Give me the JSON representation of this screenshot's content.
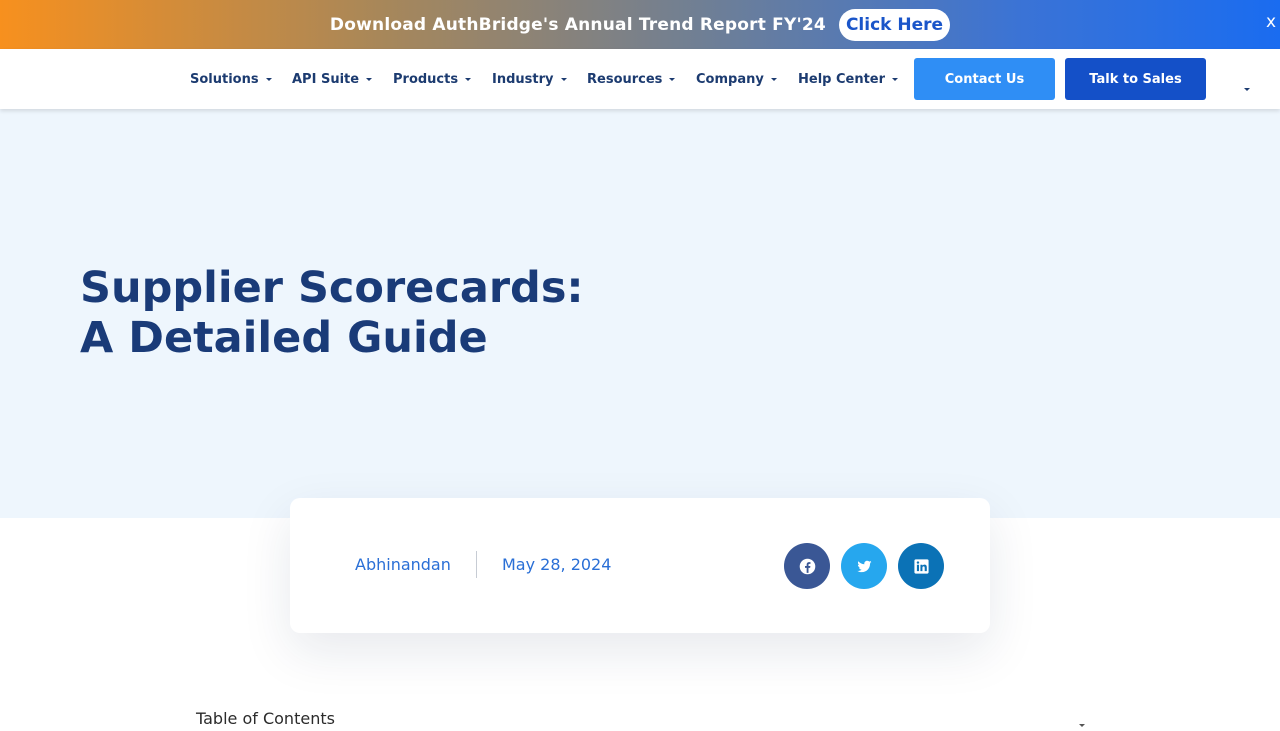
{
  "promo": {
    "text": "Download AuthBridge's Annual Trend Report FY'24",
    "button_label": "Click Here",
    "close_label": "x"
  },
  "nav": {
    "items": [
      {
        "label": "Solutions"
      },
      {
        "label": "API Suite"
      },
      {
        "label": "Products"
      },
      {
        "label": "Industry"
      },
      {
        "label": "Resources"
      },
      {
        "label": "Company"
      },
      {
        "label": "Help Center"
      }
    ],
    "contact_label": "Contact Us",
    "sales_label": "Talk to Sales"
  },
  "hero": {
    "title_line1": "Supplier Scorecards:",
    "title_line2": "A Detailed Guide"
  },
  "meta": {
    "author": "Abhinandan",
    "date": "May 28, 2024",
    "share": [
      {
        "icon": "facebook-icon",
        "color": "#3a5795"
      },
      {
        "icon": "twitter-icon",
        "color": "#26a7ee"
      },
      {
        "icon": "linkedin-icon",
        "color": "#0b72b6"
      }
    ]
  },
  "toc": {
    "title": "Table of Contents"
  },
  "colors": {
    "brand_dark": "#1a3b78",
    "link_blue": "#2a6fd6",
    "contact_button": "#2f8ef5",
    "sales_button": "#1450c8",
    "hero_background": "#eef6fd"
  }
}
